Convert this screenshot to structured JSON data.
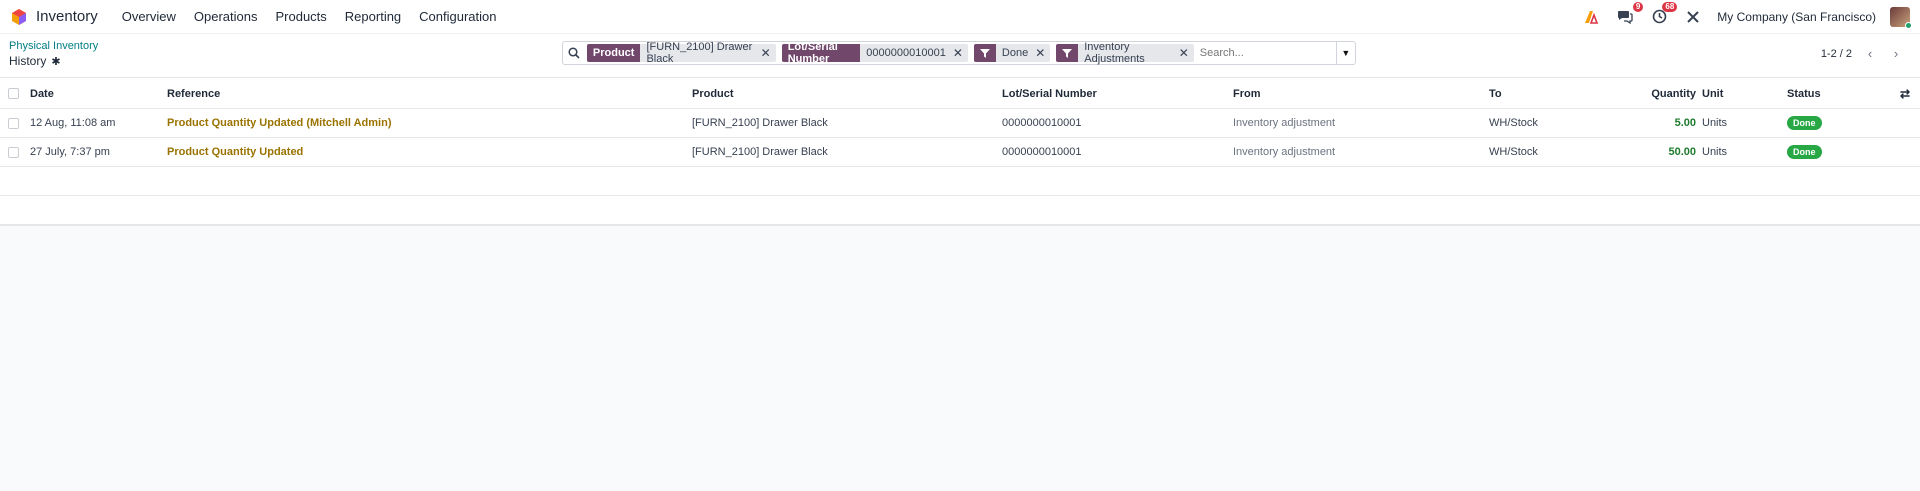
{
  "navbar": {
    "app_name": "Inventory",
    "menu": [
      "Overview",
      "Operations",
      "Products",
      "Reporting",
      "Configuration"
    ],
    "messages_count": "9",
    "activities_count": "68",
    "company": "My Company (San Francisco)"
  },
  "control": {
    "breadcrumb": "Physical Inventory",
    "title": "History",
    "search": {
      "facets": [
        {
          "label": "Product",
          "value": "[FURN_2100] Drawer Black"
        },
        {
          "label": "Lot/Serial Number",
          "value": "0000000010001"
        },
        {
          "label": "filter",
          "value": "Done"
        },
        {
          "label": "filter",
          "value": "Inventory Adjustments"
        }
      ],
      "placeholder": "Search..."
    },
    "pager": "1-2 / 2"
  },
  "table": {
    "columns": {
      "date": "Date",
      "reference": "Reference",
      "product": "Product",
      "lot": "Lot/Serial Number",
      "from": "From",
      "to": "To",
      "quantity": "Quantity",
      "unit": "Unit",
      "status": "Status"
    },
    "rows": [
      {
        "date": "12 Aug, 11:08 am",
        "reference": "Product Quantity Updated (Mitchell Admin)",
        "product": "[FURN_2100] Drawer Black",
        "lot": "0000000010001",
        "from": "Inventory adjustment",
        "to": "WH/Stock",
        "quantity": "5.00",
        "unit": "Units",
        "status": "Done"
      },
      {
        "date": "27 July, 7:37 pm",
        "reference": "Product Quantity Updated",
        "product": "[FURN_2100] Drawer Black",
        "lot": "0000000010001",
        "from": "Inventory adjustment",
        "to": "WH/Stock",
        "quantity": "50.00",
        "unit": "Units",
        "status": "Done"
      }
    ]
  },
  "colors": {
    "facet": "#71476c",
    "breadcrumb": "#017e84",
    "reference_link": "#9a7300",
    "done": "#28a745",
    "quantity": "#1d7a2e"
  }
}
